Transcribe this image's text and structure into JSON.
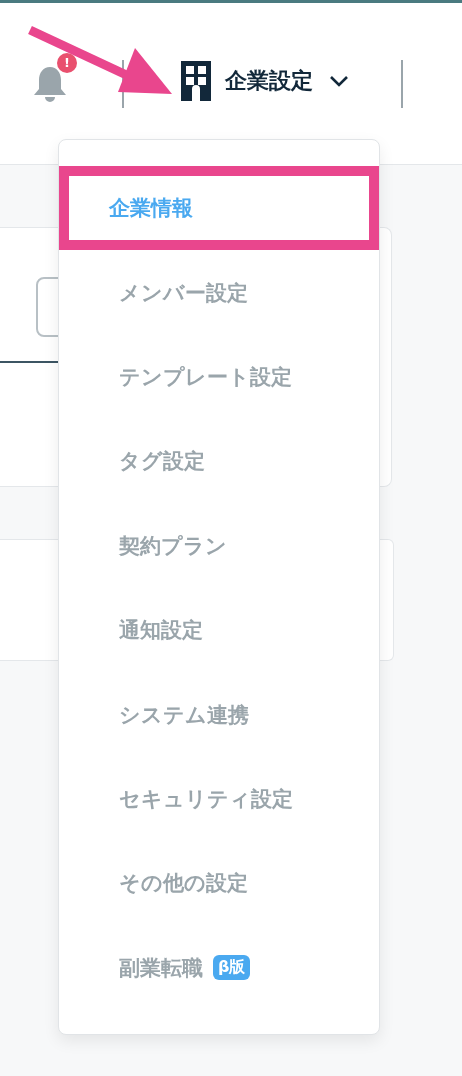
{
  "header": {
    "notification_badge": "!",
    "company_menu": {
      "label": "企業設定",
      "expanded": true
    }
  },
  "menu": [
    {
      "label": "企業情報",
      "selected": true
    },
    {
      "label": "メンバー設定",
      "selected": false
    },
    {
      "label": "テンプレート設定",
      "selected": false
    },
    {
      "label": "タグ設定",
      "selected": false
    },
    {
      "label": "契約プラン",
      "selected": false
    },
    {
      "label": "通知設定",
      "selected": false
    },
    {
      "label": "システム連携",
      "selected": false
    },
    {
      "label": "セキュリティ設定",
      "selected": false
    },
    {
      "label": "その他の設定",
      "selected": false
    },
    {
      "label": "副業転職",
      "selected": false,
      "badge": "β版"
    }
  ]
}
